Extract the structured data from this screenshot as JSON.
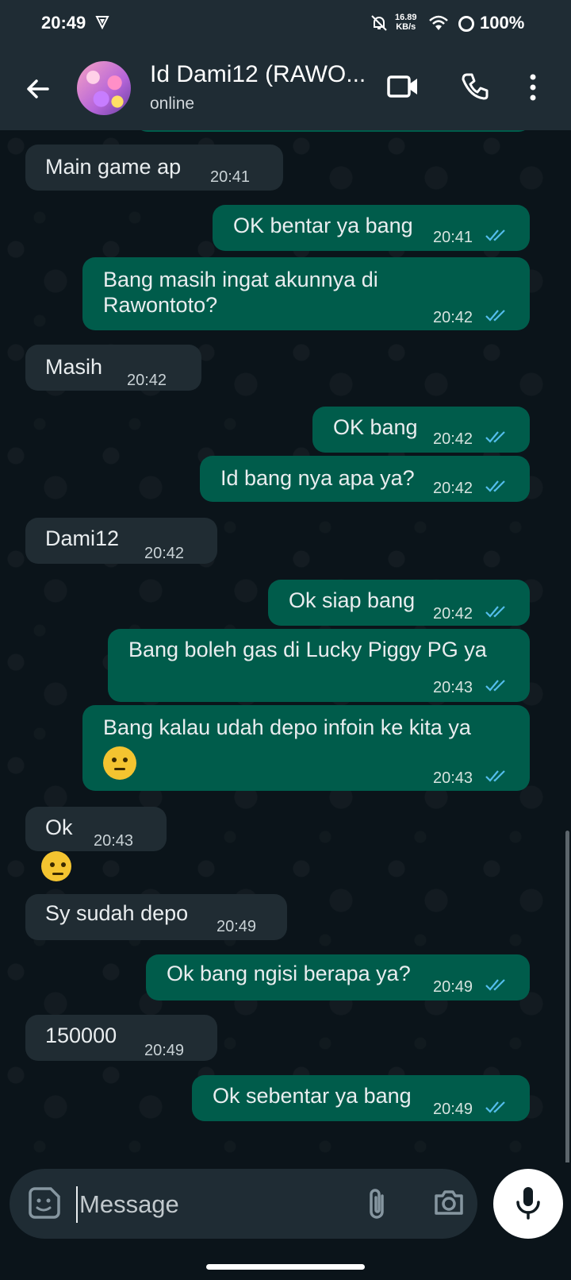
{
  "status_bar": {
    "time": "20:49",
    "net_speed_value": "16.89",
    "net_speed_unit": "KB/s",
    "battery": "100%"
  },
  "header": {
    "contact_name": "Id Dami12 (RAWO...",
    "contact_status": "online"
  },
  "messages": [
    {
      "dir": "in",
      "text": "Main game ap",
      "time": "20:41"
    },
    {
      "dir": "out",
      "text": "OK bentar ya bang",
      "time": "20:41",
      "read": true
    },
    {
      "dir": "out",
      "line1": "Bang masih ingat akunnya di",
      "line2": "Rawontoto?",
      "time": "20:42",
      "read": true
    },
    {
      "dir": "in",
      "text": "Masih",
      "time": "20:42"
    },
    {
      "dir": "out",
      "text": "OK bang",
      "time": "20:42",
      "read": true
    },
    {
      "dir": "out",
      "text": "Id bang nya apa ya?",
      "time": "20:42",
      "read": true
    },
    {
      "dir": "in",
      "text": "Dami12",
      "time": "20:42"
    },
    {
      "dir": "out",
      "text": "Ok siap bang",
      "time": "20:42",
      "read": true
    },
    {
      "dir": "out",
      "text": "Bang boleh gas di Lucky Piggy PG ya",
      "time": "20:43",
      "read": true
    },
    {
      "dir": "out",
      "text": "Bang kalau udah depo infoin ke kita ya",
      "emoji": "saluting-face",
      "time": "20:43",
      "read": true
    },
    {
      "dir": "in",
      "text": "Ok",
      "emoji": "saluting-face",
      "time": "20:43"
    },
    {
      "dir": "in",
      "text": "Sy sudah depo",
      "time": "20:49"
    },
    {
      "dir": "out",
      "text": "Ok bang ngisi berapa ya?",
      "time": "20:49",
      "read": true
    },
    {
      "dir": "in",
      "text": "150000",
      "time": "20:49"
    },
    {
      "dir": "out",
      "text": "Ok sebentar ya bang",
      "time": "20:49",
      "read": true
    }
  ],
  "composer": {
    "placeholder": "Message"
  },
  "colors": {
    "header_bg": "#1f2c34",
    "chat_bg": "#0b141a",
    "incoming_bubble": "#202c33",
    "outgoing_bubble": "#005c4b",
    "read_ticks": "#53bdeb"
  },
  "icons": [
    "vpn-icon",
    "bell-off-icon",
    "wifi-icon",
    "battery-icon",
    "back-icon",
    "video-call-icon",
    "phone-icon",
    "more-options-icon",
    "sticker-icon",
    "attach-icon",
    "camera-icon",
    "mic-icon",
    "read-ticks-icon"
  ]
}
